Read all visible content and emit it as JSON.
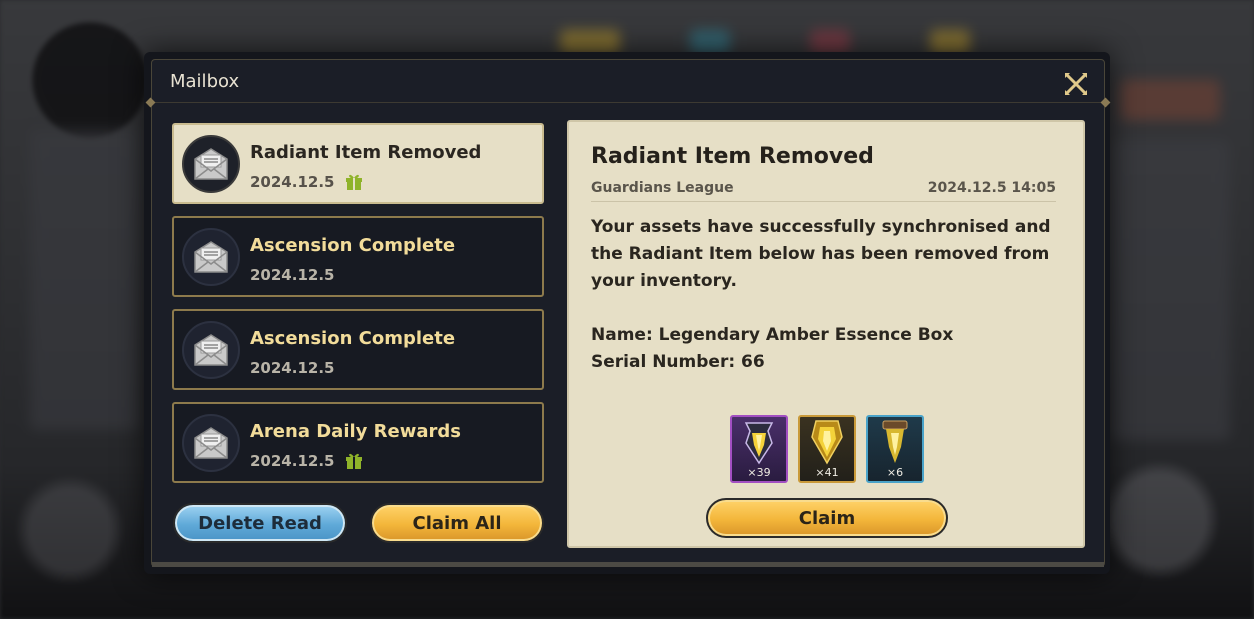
{
  "window": {
    "title": "Mailbox"
  },
  "mail_list": [
    {
      "title": "Radiant Item Removed",
      "date": "2024.12.5",
      "has_gift": true,
      "selected": true
    },
    {
      "title": "Ascension Complete",
      "date": "2024.12.5",
      "has_gift": false,
      "selected": false
    },
    {
      "title": "Ascension Complete",
      "date": "2024.12.5",
      "has_gift": false,
      "selected": false
    },
    {
      "title": "Arena Daily Rewards",
      "date": "2024.12.5",
      "has_gift": true,
      "selected": false
    }
  ],
  "buttons": {
    "delete_read": "Delete Read",
    "claim_all": "Claim All",
    "claim": "Claim"
  },
  "detail": {
    "title": "Radiant Item Removed",
    "sender": "Guardians League",
    "timestamp": "2024.12.5 14:05",
    "body": "Your assets have successfully synchronised and the Radiant Item below has been removed from your inventory.",
    "name_line": "Name: Legendary Amber Essence Box",
    "serial_line": "Serial Number: 66",
    "rewards": [
      {
        "count": "×39",
        "rarity_color": "#a24fc2",
        "icon": "amber-essence-purple-icon"
      },
      {
        "count": "×41",
        "rarity_color": "#c99a3a",
        "icon": "amber-essence-gold-icon"
      },
      {
        "count": "×6",
        "rarity_color": "#4aa3c9",
        "icon": "amber-essence-blue-icon"
      }
    ]
  },
  "colors": {
    "accent_gold": "#f3b63a",
    "accent_blue": "#5fa9d8",
    "gift_green": "#8fb32a"
  }
}
